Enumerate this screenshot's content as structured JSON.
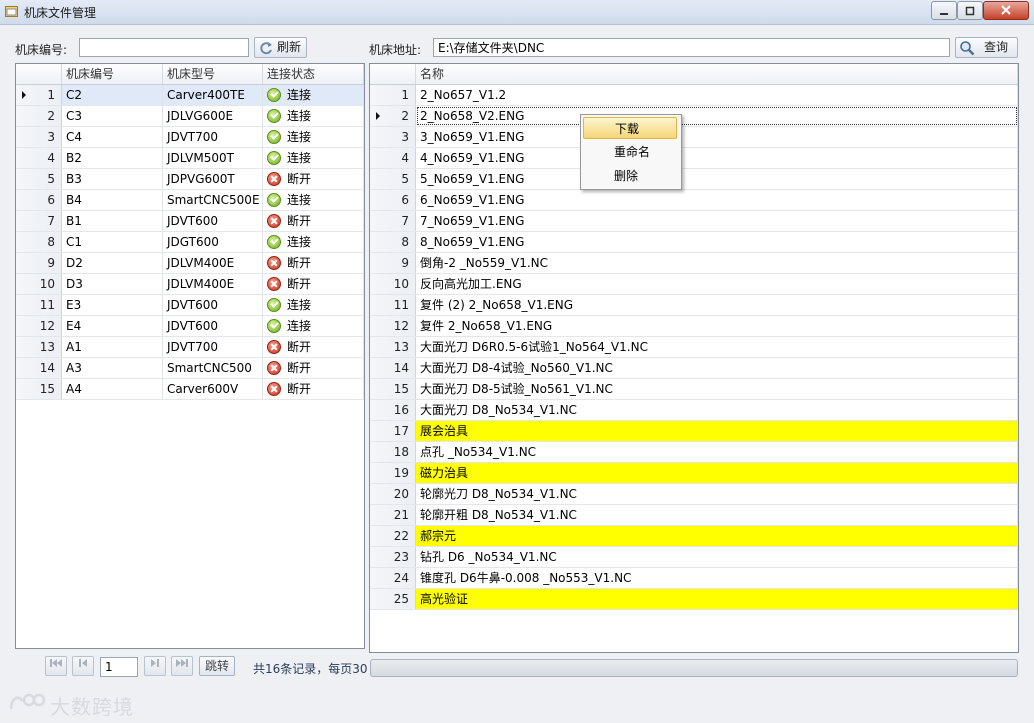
{
  "window": {
    "title": "机床文件管理",
    "minimize": "0",
    "maximize": "1",
    "close": "r"
  },
  "toolbar": {
    "machine_no_label": "机床编号:",
    "machine_no_value": "",
    "refresh_label": "刷新",
    "address_label": "机床地址:",
    "address_value": "E:\\存储文件夹\\DNC",
    "query_label": "查询"
  },
  "machines": {
    "columns": [
      "机床编号",
      "机床型号",
      "连接状态"
    ],
    "selected_row": 1,
    "rows": [
      {
        "num": "1",
        "id": "C2",
        "model": "Carver400TE",
        "status": "连接",
        "ok": true
      },
      {
        "num": "2",
        "id": "C3",
        "model": "JDLVG600E",
        "status": "连接",
        "ok": true
      },
      {
        "num": "3",
        "id": "C4",
        "model": "JDVT700",
        "status": "连接",
        "ok": true
      },
      {
        "num": "4",
        "id": "B2",
        "model": "JDLVM500T",
        "status": "连接",
        "ok": true
      },
      {
        "num": "5",
        "id": "B3",
        "model": "JDPVG600T",
        "status": "断开",
        "ok": false
      },
      {
        "num": "6",
        "id": "B4",
        "model": "SmartCNC500E",
        "status": "连接",
        "ok": true
      },
      {
        "num": "7",
        "id": "B1",
        "model": "JDVT600",
        "status": "断开",
        "ok": false
      },
      {
        "num": "8",
        "id": "C1",
        "model": "JDGT600",
        "status": "连接",
        "ok": true
      },
      {
        "num": "9",
        "id": "D2",
        "model": "JDLVM400E",
        "status": "断开",
        "ok": false
      },
      {
        "num": "10",
        "id": "D3",
        "model": "JDLVM400E",
        "status": "断开",
        "ok": false
      },
      {
        "num": "11",
        "id": "E3",
        "model": "JDVT600",
        "status": "连接",
        "ok": true
      },
      {
        "num": "12",
        "id": "E4",
        "model": "JDVT600",
        "status": "连接",
        "ok": true
      },
      {
        "num": "13",
        "id": "A1",
        "model": "JDVT700",
        "status": "断开",
        "ok": false
      },
      {
        "num": "14",
        "id": "A3",
        "model": "SmartCNC500",
        "status": "断开",
        "ok": false
      },
      {
        "num": "15",
        "id": "A4",
        "model": "Carver600V",
        "status": "断开",
        "ok": false
      }
    ]
  },
  "files": {
    "column": "名称",
    "selected_row": 2,
    "highlight_color": "#ffff00",
    "rows": [
      {
        "num": "1",
        "name": "2_No657_V1.2",
        "hl": false
      },
      {
        "num": "2",
        "name": "2_No658_V2.ENG",
        "hl": false
      },
      {
        "num": "3",
        "name": "3_No659_V1.ENG",
        "hl": false
      },
      {
        "num": "4",
        "name": "4_No659_V1.ENG",
        "hl": false
      },
      {
        "num": "5",
        "name": "5_No659_V1.ENG",
        "hl": false
      },
      {
        "num": "6",
        "name": "6_No659_V1.ENG",
        "hl": false
      },
      {
        "num": "7",
        "name": "7_No659_V1.ENG",
        "hl": false
      },
      {
        "num": "8",
        "name": "8_No659_V1.ENG",
        "hl": false
      },
      {
        "num": "9",
        "name": "倒角-2 _No559_V1.NC",
        "hl": false
      },
      {
        "num": "10",
        "name": "反向高光加工.ENG",
        "hl": false
      },
      {
        "num": "11",
        "name": "复件 (2) 2_No658_V1.ENG",
        "hl": false
      },
      {
        "num": "12",
        "name": "复件 2_No658_V1.ENG",
        "hl": false
      },
      {
        "num": "13",
        "name": "大面光刀 D6R0.5-6试验1_No564_V1.NC",
        "hl": false
      },
      {
        "num": "14",
        "name": "大面光刀 D8-4试验_No560_V1.NC",
        "hl": false
      },
      {
        "num": "15",
        "name": "大面光刀 D8-5试验_No561_V1.NC",
        "hl": false
      },
      {
        "num": "16",
        "name": "大面光刀 D8_No534_V1.NC",
        "hl": false
      },
      {
        "num": "17",
        "name": "展会治具",
        "hl": true
      },
      {
        "num": "18",
        "name": "点孔 _No534_V1.NC",
        "hl": false
      },
      {
        "num": "19",
        "name": "磁力治具",
        "hl": true
      },
      {
        "num": "20",
        "name": "轮廓光刀 D8_No534_V1.NC",
        "hl": false
      },
      {
        "num": "21",
        "name": "轮廓开粗 D8_No534_V1.NC",
        "hl": false
      },
      {
        "num": "22",
        "name": "郝宗元",
        "hl": true
      },
      {
        "num": "23",
        "name": "钻孔 D6 _No534_V1.NC",
        "hl": false
      },
      {
        "num": "24",
        "name": "锥度孔 D6牛鼻-0.008 _No553_V1.NC",
        "hl": false
      },
      {
        "num": "25",
        "name": "高光验证",
        "hl": true
      }
    ]
  },
  "context_menu": {
    "items": [
      "下载",
      "重命名",
      "删除"
    ],
    "active_index": 0
  },
  "pager": {
    "first_icon": "first-page-icon",
    "prev_icon": "prev-page-icon",
    "next_icon": "next-page-icon",
    "last_icon": "last-page-icon",
    "page_value": "1",
    "jump_label": "跳转",
    "summary": "共16条记录，每页30"
  },
  "watermark": {
    "text": "大数跨境"
  }
}
